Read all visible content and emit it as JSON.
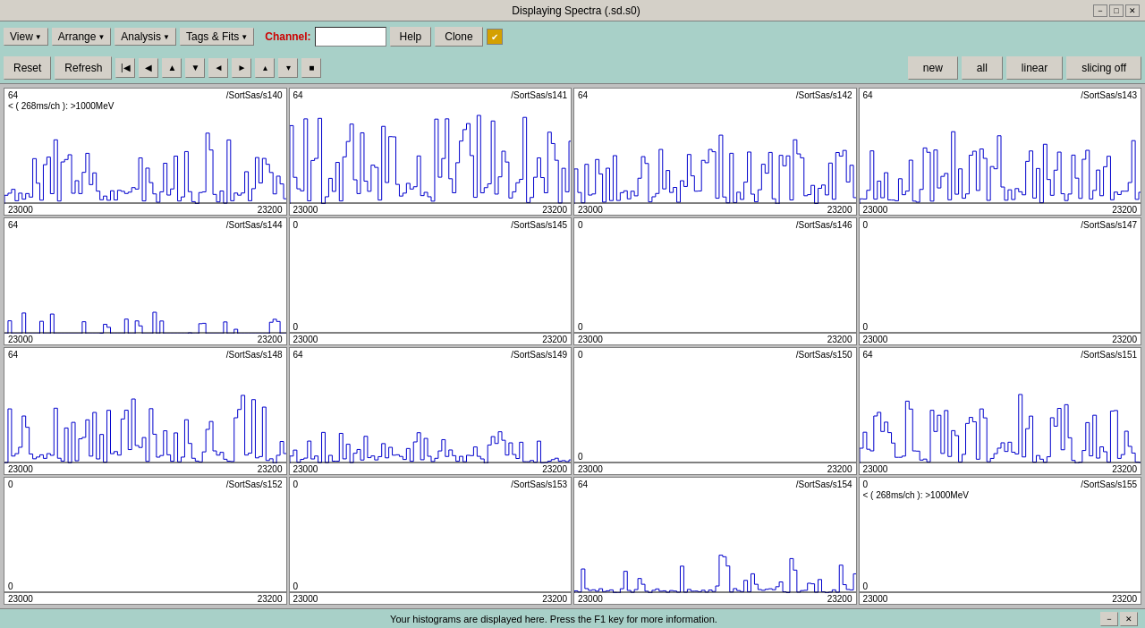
{
  "titleBar": {
    "title": "Displaying Spectra (.sd.s0)",
    "minimize": "−",
    "maximize": "□",
    "close": "✕"
  },
  "menuBar": {
    "items": [
      {
        "label": "View",
        "arrow": "▼"
      },
      {
        "label": "Arrange",
        "arrow": "▼"
      },
      {
        "label": "Analysis",
        "arrow": "▼"
      },
      {
        "label": "Tags & Fits",
        "arrow": "▼"
      }
    ],
    "channelLabel": "Channel:",
    "channelValue": "",
    "helpLabel": "Help",
    "cloneLabel": "Clone",
    "checkboxChecked": "✔"
  },
  "toolbar": {
    "resetLabel": "Reset",
    "refreshLabel": "Refresh",
    "newLabel": "new",
    "allLabel": "all",
    "linearLabel": "linear",
    "slicingLabel": "slicing off"
  },
  "charts": [
    {
      "id": "s140",
      "name": "/SortSas/s140",
      "ymax": "64",
      "ymin": "",
      "subtitle": "< ( 268ms/ch ): >1000MeV",
      "xmin": "23000",
      "xmax": "23200",
      "hasData": true,
      "dataType": "medium"
    },
    {
      "id": "s141",
      "name": "/SortSas/s141",
      "ymax": "64",
      "ymin": "",
      "subtitle": "",
      "xmin": "23000",
      "xmax": "23200",
      "hasData": true,
      "dataType": "high"
    },
    {
      "id": "s142",
      "name": "/SortSas/s142",
      "ymax": "64",
      "ymin": "",
      "subtitle": "",
      "xmin": "23000",
      "xmax": "23200",
      "hasData": true,
      "dataType": "medium"
    },
    {
      "id": "s143",
      "name": "/SortSas/s143",
      "ymax": "64",
      "ymin": "",
      "subtitle": "",
      "xmin": "23000",
      "xmax": "23200",
      "hasData": true,
      "dataType": "medium"
    },
    {
      "id": "s144",
      "name": "/SortSas/s144",
      "ymax": "64",
      "ymin": "",
      "subtitle": "",
      "xmin": "23000",
      "xmax": "23200",
      "hasData": true,
      "dataType": "sparse"
    },
    {
      "id": "s145",
      "name": "/SortSas/s145",
      "ymax": "0",
      "ymin": "0",
      "subtitle": "",
      "xmin": "23000",
      "xmax": "23200",
      "hasData": false,
      "dataType": "none"
    },
    {
      "id": "s146",
      "name": "/SortSas/s146",
      "ymax": "0",
      "ymin": "0",
      "subtitle": "",
      "xmin": "23000",
      "xmax": "23200",
      "hasData": false,
      "dataType": "none"
    },
    {
      "id": "s147",
      "name": "/SortSas/s147",
      "ymax": "0",
      "ymin": "0",
      "subtitle": "",
      "xmin": "23000",
      "xmax": "23200",
      "hasData": false,
      "dataType": "none"
    },
    {
      "id": "s148",
      "name": "/SortSas/s148",
      "ymax": "64",
      "ymin": "",
      "subtitle": "",
      "xmin": "23000",
      "xmax": "23200",
      "hasData": true,
      "dataType": "medium"
    },
    {
      "id": "s149",
      "name": "/SortSas/s149",
      "ymax": "64",
      "ymin": "",
      "subtitle": "",
      "xmin": "23000",
      "xmax": "23200",
      "hasData": true,
      "dataType": "low"
    },
    {
      "id": "s150",
      "name": "/SortSas/s150",
      "ymax": "0",
      "ymin": "0",
      "subtitle": "",
      "xmin": "23000",
      "xmax": "23200",
      "hasData": false,
      "dataType": "none"
    },
    {
      "id": "s151",
      "name": "/SortSas/s151",
      "ymax": "64",
      "ymin": "",
      "subtitle": "",
      "xmin": "23000",
      "xmax": "23200",
      "hasData": true,
      "dataType": "medium"
    },
    {
      "id": "s152",
      "name": "/SortSas/s152",
      "ymax": "0",
      "ymin": "0",
      "subtitle": "",
      "xmin": "23000",
      "xmax": "23200",
      "hasData": false,
      "dataType": "none"
    },
    {
      "id": "s153",
      "name": "/SortSas/s153",
      "ymax": "0",
      "ymin": "0",
      "subtitle": "",
      "xmin": "23000",
      "xmax": "23200",
      "hasData": false,
      "dataType": "none"
    },
    {
      "id": "s154",
      "name": "/SortSas/s154",
      "ymax": "64",
      "ymin": "",
      "subtitle": "",
      "xmin": "23000",
      "xmax": "23200",
      "hasData": true,
      "dataType": "low-sparse"
    },
    {
      "id": "s155",
      "name": "/SortSas/s155",
      "ymax": "0",
      "ymin": "0",
      "subtitle": "< ( 268ms/ch ): >1000MeV",
      "xmin": "23000",
      "xmax": "23200",
      "hasData": false,
      "dataType": "none"
    }
  ],
  "statusBar": {
    "text": "Your histograms are displayed here. Press the F1 key for more information.",
    "btnMinus": "−",
    "btnX": "✕"
  }
}
